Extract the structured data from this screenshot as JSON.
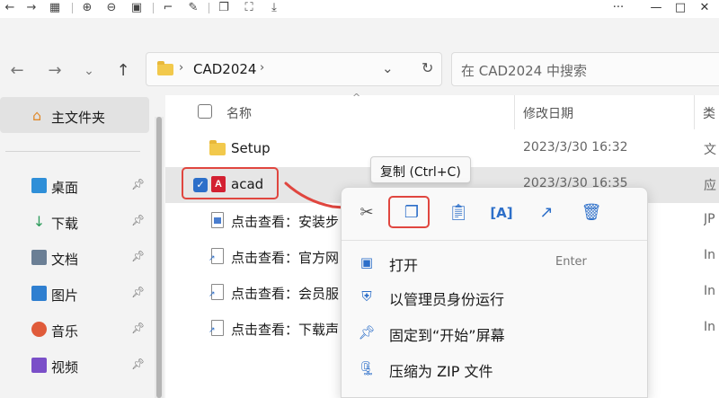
{
  "toolbar": {
    "icons": [
      "back-arrow-icon",
      "forward-arrow-icon",
      "grid-icon",
      "zoom-in-icon",
      "zoom-out-icon",
      "fit-icon",
      "crop-icon",
      "edit-icon",
      "copy-icon",
      "screenshot-icon",
      "save-icon"
    ],
    "window": {
      "more": "···",
      "minimize": "—",
      "maximize": "□",
      "close": "✕"
    }
  },
  "nav": {
    "back": "←",
    "forward": "→",
    "recent": "⌄",
    "up": "↑",
    "breadcrumb": "CAD2024",
    "search_placeholder": "在 CAD2024 中搜索"
  },
  "sidebar": {
    "home": "主文件夹",
    "items": [
      {
        "label": "桌面",
        "color": "#2f8fd8"
      },
      {
        "label": "下载",
        "color": "#2c9a5a"
      },
      {
        "label": "文档",
        "color": "#6b7f95"
      },
      {
        "label": "图片",
        "color": "#2f7fd0"
      },
      {
        "label": "音乐",
        "color": "#e05b3a"
      },
      {
        "label": "视频",
        "color": "#7a4fc8"
      }
    ]
  },
  "columns": {
    "name": "名称",
    "modified": "修改日期",
    "type": "类"
  },
  "files": [
    {
      "name": "Setup",
      "date": "2023/3/30 16:32",
      "type": "文",
      "icon": "folder-icon"
    },
    {
      "name": "acad",
      "date": "2023/3/30 16:35",
      "type": "应",
      "icon": "autocad-icon",
      "logo": "A"
    },
    {
      "name": "点击查看：安装步",
      "date": "",
      "type": "JP",
      "icon": "image-file-icon"
    },
    {
      "name": "点击查看：官方网",
      "date": "",
      "type": "In",
      "icon": "shortcut-file-icon"
    },
    {
      "name": "点击查看：会员服",
      "date": "",
      "type": "In",
      "icon": "shortcut-file-icon"
    },
    {
      "name": "点击查看：下载声",
      "date": "",
      "type": "In",
      "icon": "shortcut-file-icon"
    }
  ],
  "tooltip": "复制 (Ctrl+C)",
  "context_menu": {
    "quick_actions": [
      "cut-icon",
      "copy-icon",
      "paste-icon",
      "rename-icon",
      "share-icon",
      "delete-icon"
    ],
    "items": [
      {
        "label": "打开",
        "shortcut": "Enter",
        "icon": "open-icon"
      },
      {
        "label": "以管理员身份运行",
        "shortcut": "",
        "icon": "shield-icon"
      },
      {
        "label": "固定到“开始”屏幕",
        "shortcut": "",
        "icon": "pin-icon"
      },
      {
        "label": "压缩为 ZIP 文件",
        "shortcut": "",
        "icon": "zip-icon"
      }
    ]
  },
  "accent_color": "#2d6fc9",
  "highlight_color": "#e0463f"
}
